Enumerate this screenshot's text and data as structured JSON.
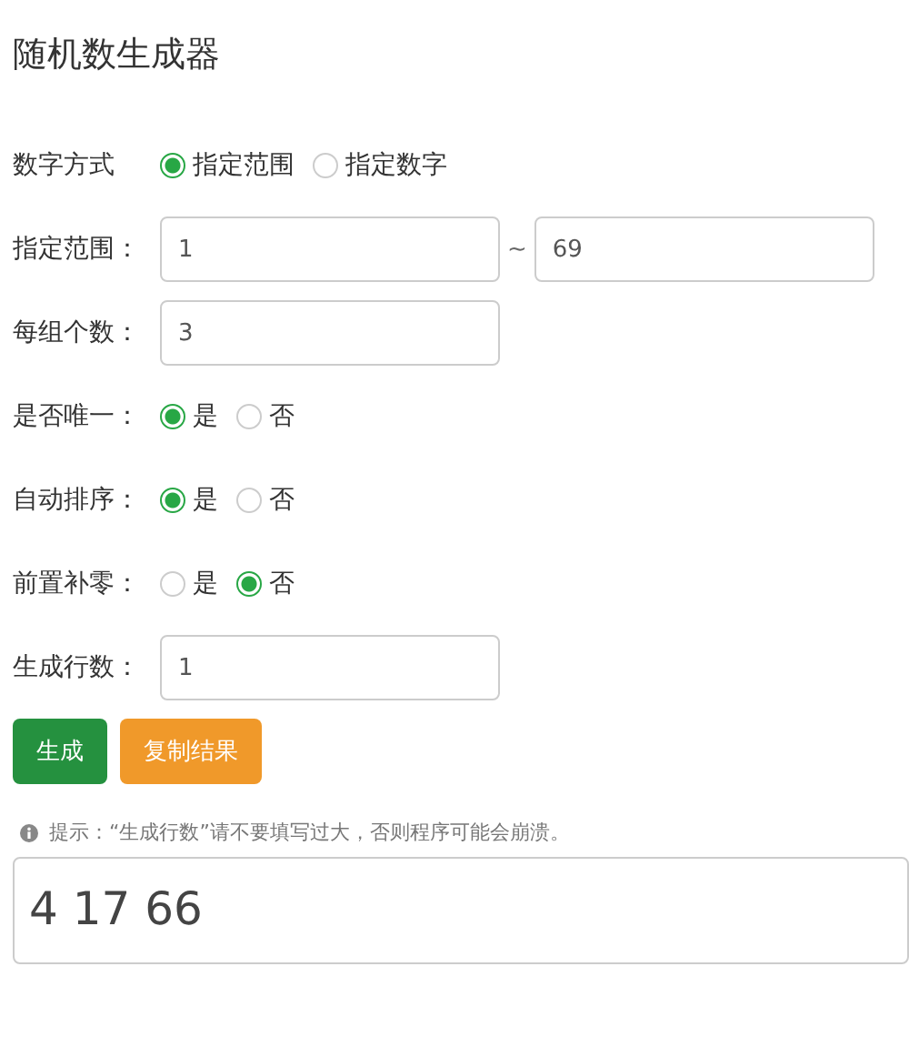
{
  "title": "随机数生成器",
  "rows": [
    {
      "kind": "radio",
      "label": "数字方式",
      "options": [
        {
          "label": "指定范围",
          "selected": true
        },
        {
          "label": "指定数字",
          "selected": false
        }
      ]
    },
    {
      "kind": "range",
      "label": "指定范围：",
      "from": "1",
      "separator": "~",
      "to": "69"
    },
    {
      "kind": "input",
      "label": "每组个数：",
      "value": "3"
    },
    {
      "kind": "radio",
      "label": "是否唯一：",
      "options": [
        {
          "label": "是",
          "selected": true
        },
        {
          "label": "否",
          "selected": false
        }
      ]
    },
    {
      "kind": "radio",
      "label": "自动排序：",
      "options": [
        {
          "label": "是",
          "selected": true
        },
        {
          "label": "否",
          "selected": false
        }
      ]
    },
    {
      "kind": "radio",
      "label": "前置补零：",
      "options": [
        {
          "label": "是",
          "selected": false
        },
        {
          "label": "否",
          "selected": true
        }
      ]
    },
    {
      "kind": "input",
      "label": "生成行数：",
      "value": "1"
    }
  ],
  "buttons": [
    {
      "label": "生成",
      "kind": "primary"
    },
    {
      "label": "复制结果",
      "kind": "warning"
    }
  ],
  "hint": "提示：“生成行数”请不要填写过大，否则程序可能会崩溃。",
  "result": "4 17 66"
}
